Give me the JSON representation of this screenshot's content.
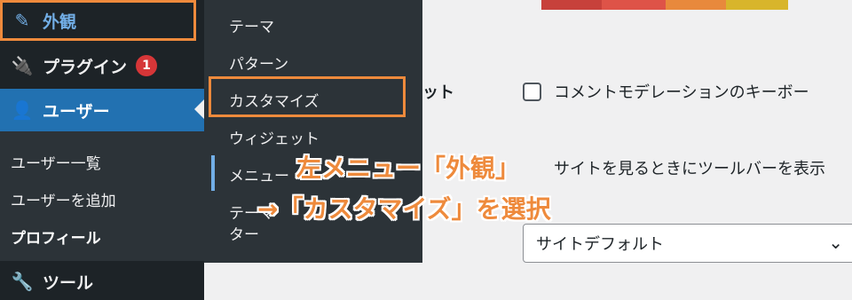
{
  "sidebar": {
    "appearance": {
      "label": "外観",
      "icon": "paintbrush-icon"
    },
    "plugins": {
      "label": "プラグイン",
      "badge": "1",
      "icon": "plug-icon"
    },
    "users": {
      "label": "ユーザー",
      "icon": "user-icon"
    },
    "users_submenu": [
      "ユーザー一覧",
      "ユーザーを追加",
      "プロフィール"
    ],
    "tools": {
      "label": "ツール",
      "icon": "wrench-icon"
    }
  },
  "flyout": {
    "items": [
      "テーマ",
      "パターン",
      "カスタマイズ",
      "ウィジェット",
      "メニュー",
      "テーマファイルエディター"
    ],
    "menu_visible": "メニュー",
    "editor_line1": "テーマ",
    "editor_line2": "ター"
  },
  "content": {
    "row1_label_fragment": "ット",
    "checkbox1_label": "コメントモデレーションのキーボー",
    "checkbox2_label": "サイトを見るときにツールバーを表示",
    "select_value": "サイトデフォルト"
  },
  "annotation": {
    "line1": "左メニュー「外観」",
    "line2": "→「カスタマイズ」を選択"
  },
  "colors": {
    "sidebar_bg": "#1d2327",
    "submenu_bg": "#2c3338",
    "active_blue": "#2271b1",
    "link_blue": "#72aee6",
    "highlight_orange": "#ee8a3c",
    "badge_red": "#d63638",
    "palette": [
      "#c7413b",
      "#de5348",
      "#e8893c",
      "#d8b52b"
    ]
  }
}
